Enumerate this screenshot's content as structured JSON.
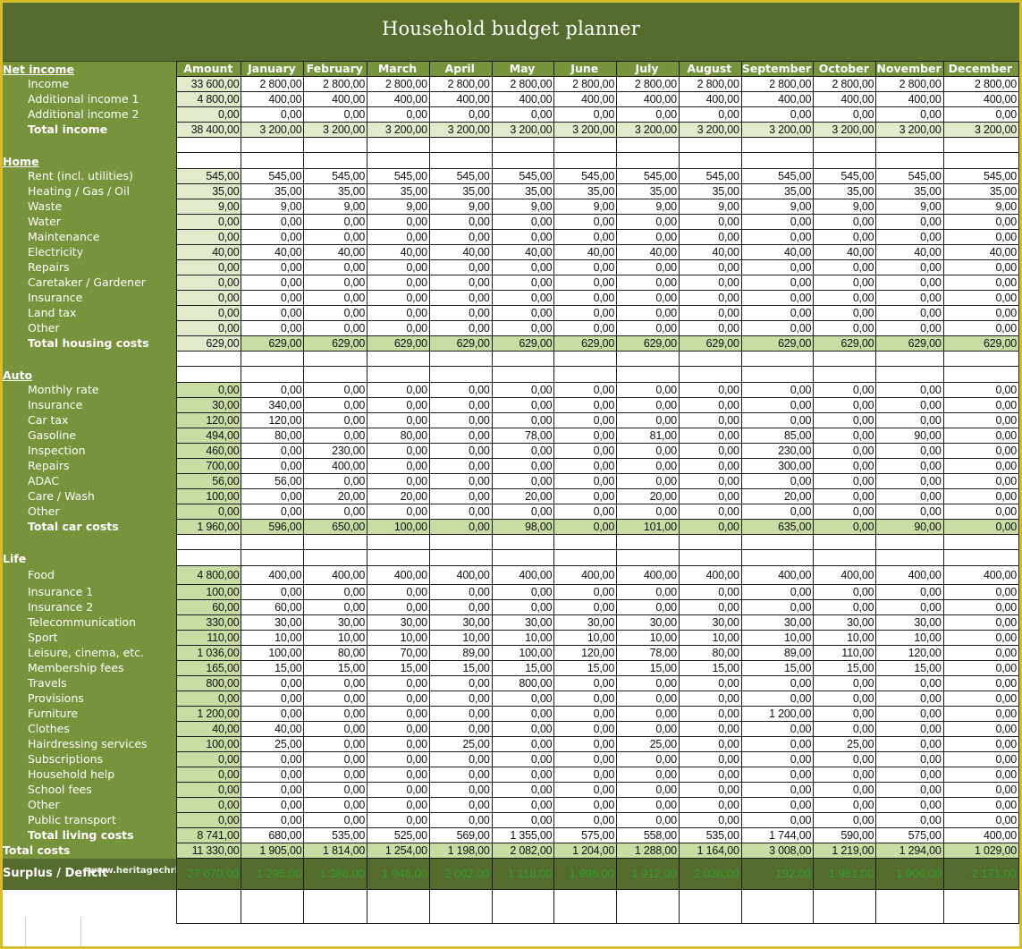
{
  "title": "Household budget planner",
  "watermark": "www.heritagechristiancollege.com",
  "columns": [
    "Amount",
    "January",
    "February",
    "March",
    "April",
    "May",
    "June",
    "July",
    "August",
    "September",
    "October",
    "November",
    "December"
  ],
  "sections": [
    {
      "key": "income",
      "heading": "Net income",
      "rows": [
        {
          "label": "Income",
          "values": [
            "33 600,00",
            "2 800,00",
            "2 800,00",
            "2 800,00",
            "2 800,00",
            "2 800,00",
            "2 800,00",
            "2 800,00",
            "2 800,00",
            "2 800,00",
            "2 800,00",
            "2 800,00",
            "2 800,00"
          ]
        },
        {
          "label": "Additional income 1",
          "values": [
            "4 800,00",
            "400,00",
            "400,00",
            "400,00",
            "400,00",
            "400,00",
            "400,00",
            "400,00",
            "400,00",
            "400,00",
            "400,00",
            "400,00",
            "400,00"
          ]
        },
        {
          "label": "Additional income 2",
          "values": [
            "0,00",
            "0,00",
            "0,00",
            "0,00",
            "0,00",
            "0,00",
            "0,00",
            "0,00",
            "0,00",
            "0,00",
            "0,00",
            "0,00",
            "0,00"
          ]
        }
      ],
      "total": {
        "label": "Total income",
        "values": [
          "38 400,00",
          "3 200,00",
          "3 200,00",
          "3 200,00",
          "3 200,00",
          "3 200,00",
          "3 200,00",
          "3 200,00",
          "3 200,00",
          "3 200,00",
          "3 200,00",
          "3 200,00",
          "3 200,00"
        ]
      }
    },
    {
      "key": "home",
      "heading": "Home",
      "rows": [
        {
          "label": "Rent (incl. utilities)",
          "values": [
            "545,00",
            "545,00",
            "545,00",
            "545,00",
            "545,00",
            "545,00",
            "545,00",
            "545,00",
            "545,00",
            "545,00",
            "545,00",
            "545,00",
            "545,00"
          ]
        },
        {
          "label": "Heating / Gas / Oil",
          "values": [
            "35,00",
            "35,00",
            "35,00",
            "35,00",
            "35,00",
            "35,00",
            "35,00",
            "35,00",
            "35,00",
            "35,00",
            "35,00",
            "35,00",
            "35,00"
          ]
        },
        {
          "label": "Waste",
          "values": [
            "9,00",
            "9,00",
            "9,00",
            "9,00",
            "9,00",
            "9,00",
            "9,00",
            "9,00",
            "9,00",
            "9,00",
            "9,00",
            "9,00",
            "9,00"
          ]
        },
        {
          "label": "Water",
          "values": [
            "0,00",
            "0,00",
            "0,00",
            "0,00",
            "0,00",
            "0,00",
            "0,00",
            "0,00",
            "0,00",
            "0,00",
            "0,00",
            "0,00",
            "0,00"
          ]
        },
        {
          "label": "Maintenance",
          "values": [
            "0,00",
            "0,00",
            "0,00",
            "0,00",
            "0,00",
            "0,00",
            "0,00",
            "0,00",
            "0,00",
            "0,00",
            "0,00",
            "0,00",
            "0,00"
          ]
        },
        {
          "label": "Electricity",
          "values": [
            "40,00",
            "40,00",
            "40,00",
            "40,00",
            "40,00",
            "40,00",
            "40,00",
            "40,00",
            "40,00",
            "40,00",
            "40,00",
            "40,00",
            "40,00"
          ]
        },
        {
          "label": "Repairs",
          "values": [
            "0,00",
            "0,00",
            "0,00",
            "0,00",
            "0,00",
            "0,00",
            "0,00",
            "0,00",
            "0,00",
            "0,00",
            "0,00",
            "0,00",
            "0,00"
          ]
        },
        {
          "label": "Caretaker / Gardener",
          "values": [
            "0,00",
            "0,00",
            "0,00",
            "0,00",
            "0,00",
            "0,00",
            "0,00",
            "0,00",
            "0,00",
            "0,00",
            "0,00",
            "0,00",
            "0,00"
          ]
        },
        {
          "label": "Insurance",
          "values": [
            "0,00",
            "0,00",
            "0,00",
            "0,00",
            "0,00",
            "0,00",
            "0,00",
            "0,00",
            "0,00",
            "0,00",
            "0,00",
            "0,00",
            "0,00"
          ]
        },
        {
          "label": "Land tax",
          "values": [
            "0,00",
            "0,00",
            "0,00",
            "0,00",
            "0,00",
            "0,00",
            "0,00",
            "0,00",
            "0,00",
            "0,00",
            "0,00",
            "0,00",
            "0,00"
          ]
        },
        {
          "label": "Other",
          "values": [
            "0,00",
            "0,00",
            "0,00",
            "0,00",
            "0,00",
            "0,00",
            "0,00",
            "0,00",
            "0,00",
            "0,00",
            "0,00",
            "0,00",
            "0,00"
          ]
        }
      ],
      "total": {
        "label": "Total housing costs",
        "values": [
          "629,00",
          "629,00",
          "629,00",
          "629,00",
          "629,00",
          "629,00",
          "629,00",
          "629,00",
          "629,00",
          "629,00",
          "629,00",
          "629,00",
          "629,00"
        ]
      }
    },
    {
      "key": "auto",
      "heading": "Auto",
      "rows": [
        {
          "label": "Monthly rate",
          "values": [
            "0,00",
            "0,00",
            "0,00",
            "0,00",
            "0,00",
            "0,00",
            "0,00",
            "0,00",
            "0,00",
            "0,00",
            "0,00",
            "0,00",
            "0,00"
          ]
        },
        {
          "label": "Insurance",
          "values": [
            "30,00",
            "340,00",
            "0,00",
            "0,00",
            "0,00",
            "0,00",
            "0,00",
            "0,00",
            "0,00",
            "0,00",
            "0,00",
            "0,00",
            "0,00"
          ]
        },
        {
          "label": "Car tax",
          "values": [
            "120,00",
            "120,00",
            "0,00",
            "0,00",
            "0,00",
            "0,00",
            "0,00",
            "0,00",
            "0,00",
            "0,00",
            "0,00",
            "0,00",
            "0,00"
          ]
        },
        {
          "label": "Gasoline",
          "values": [
            "494,00",
            "80,00",
            "0,00",
            "80,00",
            "0,00",
            "78,00",
            "0,00",
            "81,00",
            "0,00",
            "85,00",
            "0,00",
            "90,00",
            "0,00"
          ]
        },
        {
          "label": "Inspection",
          "values": [
            "460,00",
            "0,00",
            "230,00",
            "0,00",
            "0,00",
            "0,00",
            "0,00",
            "0,00",
            "0,00",
            "230,00",
            "0,00",
            "0,00",
            "0,00"
          ]
        },
        {
          "label": "Repairs",
          "values": [
            "700,00",
            "0,00",
            "400,00",
            "0,00",
            "0,00",
            "0,00",
            "0,00",
            "0,00",
            "0,00",
            "300,00",
            "0,00",
            "0,00",
            "0,00"
          ]
        },
        {
          "label": "ADAC",
          "values": [
            "56,00",
            "56,00",
            "0,00",
            "0,00",
            "0,00",
            "0,00",
            "0,00",
            "0,00",
            "0,00",
            "0,00",
            "0,00",
            "0,00",
            "0,00"
          ]
        },
        {
          "label": "Care / Wash",
          "values": [
            "100,00",
            "0,00",
            "20,00",
            "20,00",
            "0,00",
            "20,00",
            "0,00",
            "20,00",
            "0,00",
            "20,00",
            "0,00",
            "0,00",
            "0,00"
          ]
        },
        {
          "label": "Other",
          "values": [
            "0,00",
            "0,00",
            "0,00",
            "0,00",
            "0,00",
            "0,00",
            "0,00",
            "0,00",
            "0,00",
            "0,00",
            "0,00",
            "0,00",
            "0,00"
          ]
        }
      ],
      "total": {
        "label": "Total car costs",
        "values": [
          "1 960,00",
          "596,00",
          "650,00",
          "100,00",
          "0,00",
          "98,00",
          "0,00",
          "101,00",
          "0,00",
          "635,00",
          "0,00",
          "90,00",
          "0,00"
        ]
      }
    },
    {
      "key": "life",
      "heading": "Life",
      "rows": [
        {
          "label": "Food",
          "values": [
            "4 800,00",
            "400,00",
            "400,00",
            "400,00",
            "400,00",
            "400,00",
            "400,00",
            "400,00",
            "400,00",
            "400,00",
            "400,00",
            "400,00",
            "400,00"
          ]
        },
        {
          "label": "Insurance 1",
          "values": [
            "100,00",
            "0,00",
            "0,00",
            "0,00",
            "0,00",
            "0,00",
            "0,00",
            "0,00",
            "0,00",
            "0,00",
            "0,00",
            "0,00",
            "0,00"
          ]
        },
        {
          "label": "Insurance 2",
          "values": [
            "60,00",
            "60,00",
            "0,00",
            "0,00",
            "0,00",
            "0,00",
            "0,00",
            "0,00",
            "0,00",
            "0,00",
            "0,00",
            "0,00",
            "0,00"
          ]
        },
        {
          "label": "Telecommunication",
          "values": [
            "330,00",
            "30,00",
            "30,00",
            "30,00",
            "30,00",
            "30,00",
            "30,00",
            "30,00",
            "30,00",
            "30,00",
            "30,00",
            "30,00",
            "0,00"
          ]
        },
        {
          "label": "Sport",
          "values": [
            "110,00",
            "10,00",
            "10,00",
            "10,00",
            "10,00",
            "10,00",
            "10,00",
            "10,00",
            "10,00",
            "10,00",
            "10,00",
            "10,00",
            "0,00"
          ]
        },
        {
          "label": "Leisure, cinema, etc.",
          "values": [
            "1 036,00",
            "100,00",
            "80,00",
            "70,00",
            "89,00",
            "100,00",
            "120,00",
            "78,00",
            "80,00",
            "89,00",
            "110,00",
            "120,00",
            "0,00"
          ]
        },
        {
          "label": "Membership fees",
          "values": [
            "165,00",
            "15,00",
            "15,00",
            "15,00",
            "15,00",
            "15,00",
            "15,00",
            "15,00",
            "15,00",
            "15,00",
            "15,00",
            "15,00",
            "0,00"
          ]
        },
        {
          "label": "Travels",
          "values": [
            "800,00",
            "0,00",
            "0,00",
            "0,00",
            "0,00",
            "800,00",
            "0,00",
            "0,00",
            "0,00",
            "0,00",
            "0,00",
            "0,00",
            "0,00"
          ]
        },
        {
          "label": "Provisions",
          "values": [
            "0,00",
            "0,00",
            "0,00",
            "0,00",
            "0,00",
            "0,00",
            "0,00",
            "0,00",
            "0,00",
            "0,00",
            "0,00",
            "0,00",
            "0,00"
          ]
        },
        {
          "label": "Furniture",
          "values": [
            "1 200,00",
            "0,00",
            "0,00",
            "0,00",
            "0,00",
            "0,00",
            "0,00",
            "0,00",
            "0,00",
            "1 200,00",
            "0,00",
            "0,00",
            "0,00"
          ]
        },
        {
          "label": "Clothes",
          "values": [
            "40,00",
            "40,00",
            "0,00",
            "0,00",
            "0,00",
            "0,00",
            "0,00",
            "0,00",
            "0,00",
            "0,00",
            "0,00",
            "0,00",
            "0,00"
          ]
        },
        {
          "label": "Hairdressing services",
          "values": [
            "100,00",
            "25,00",
            "0,00",
            "0,00",
            "25,00",
            "0,00",
            "0,00",
            "25,00",
            "0,00",
            "0,00",
            "25,00",
            "0,00",
            "0,00"
          ]
        },
        {
          "label": "Subscriptions",
          "values": [
            "0,00",
            "0,00",
            "0,00",
            "0,00",
            "0,00",
            "0,00",
            "0,00",
            "0,00",
            "0,00",
            "0,00",
            "0,00",
            "0,00",
            "0,00"
          ]
        },
        {
          "label": "Household help",
          "values": [
            "0,00",
            "0,00",
            "0,00",
            "0,00",
            "0,00",
            "0,00",
            "0,00",
            "0,00",
            "0,00",
            "0,00",
            "0,00",
            "0,00",
            "0,00"
          ]
        },
        {
          "label": "School fees",
          "values": [
            "0,00",
            "0,00",
            "0,00",
            "0,00",
            "0,00",
            "0,00",
            "0,00",
            "0,00",
            "0,00",
            "0,00",
            "0,00",
            "0,00",
            "0,00"
          ]
        },
        {
          "label": "Other",
          "values": [
            "0,00",
            "0,00",
            "0,00",
            "0,00",
            "0,00",
            "0,00",
            "0,00",
            "0,00",
            "0,00",
            "0,00",
            "0,00",
            "0,00",
            "0,00"
          ]
        },
        {
          "label": "Public transport",
          "values": [
            "0,00",
            "0,00",
            "0,00",
            "0,00",
            "0,00",
            "0,00",
            "0,00",
            "0,00",
            "0,00",
            "0,00",
            "0,00",
            "0,00",
            "0,00"
          ]
        }
      ],
      "total": {
        "label": "Total living costs",
        "values": [
          "8 741,00",
          "680,00",
          "535,00",
          "525,00",
          "569,00",
          "1 355,00",
          "575,00",
          "558,00",
          "535,00",
          "1 744,00",
          "590,00",
          "575,00",
          "400,00"
        ]
      }
    }
  ],
  "total_costs": {
    "label": "Total costs",
    "values": [
      "11 330,00",
      "1 905,00",
      "1 814,00",
      "1 254,00",
      "1 198,00",
      "2 082,00",
      "1 204,00",
      "1 288,00",
      "1 164,00",
      "3 008,00",
      "1 219,00",
      "1 294,00",
      "1 029,00"
    ]
  },
  "surplus": {
    "label": "Surplus / Deficit",
    "values": [
      "27 070,00",
      "1 295,00",
      "1 386,00",
      "1 946,00",
      "2 002,00",
      "1 118,00",
      "1 996,00",
      "1 912,00",
      "2 036,00",
      "192,00",
      "1 981,00",
      "1 906,00",
      "2 171,00"
    ]
  },
  "colors": {
    "frame": "#d8bd2a",
    "title_band": "#566b2e",
    "label_column": "#77933c",
    "amount_highlight": "#c9dca4",
    "amount_pale": "#e1eacb",
    "surplus_text": "#2ea22a"
  }
}
